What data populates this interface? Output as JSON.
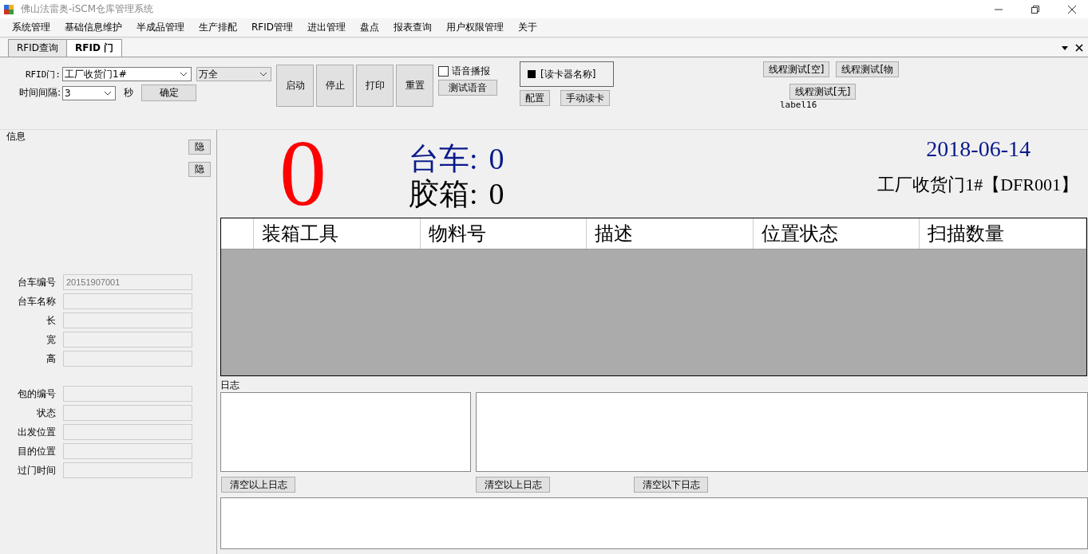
{
  "window": {
    "title": "佛山法雷奥-iSCM仓库管理系统"
  },
  "menu": [
    "系统管理",
    "基础信息维护",
    "半成品管理",
    "生产排配",
    "RFID管理",
    "进出管理",
    "盘点",
    "报表查询",
    "用户权限管理",
    "关于"
  ],
  "tabs": [
    {
      "label": "RFID查询",
      "selected": false
    },
    {
      "label": "RFID 门",
      "selected": true
    }
  ],
  "toolbar": {
    "door_label": "RFID门:",
    "door_value": "工厂收货门1#",
    "site_value": "万全",
    "interval_label": "时间间隔:",
    "interval_value": "3",
    "interval_unit": "秒",
    "confirm": "确定",
    "actions": [
      "启动",
      "停止",
      "打印",
      "重置"
    ],
    "voice": {
      "label": "语音播报",
      "checked": false
    },
    "test_voice": "测试语音",
    "reader": {
      "name": "[读卡器名称]"
    },
    "config": "配置",
    "manual_read": "手动读卡",
    "thread_tests": [
      "线程测试[空]",
      "线程测试[物",
      "线程测试[无]"
    ],
    "status_label": "label16"
  },
  "info": {
    "title": "信息",
    "hide_buttons": [
      "隐",
      "隐"
    ],
    "cart_fields": [
      {
        "label": "台车编号",
        "value": "20151907001"
      },
      {
        "label": "台车名称"
      },
      {
        "label": "长"
      },
      {
        "label": "宽"
      },
      {
        "label": "高"
      }
    ],
    "box_fields": [
      {
        "label": "包的编号"
      },
      {
        "label": "状态"
      },
      {
        "label": "出发位置"
      },
      {
        "label": "目的位置"
      },
      {
        "label": "过门时间"
      }
    ]
  },
  "display": {
    "count": "0",
    "cart_label": "台车:",
    "cart_count": "0",
    "box_label": "胶箱:",
    "box_count": "0",
    "date": "2018-06-14",
    "door_name": "工厂收货门1#【DFR001】"
  },
  "table": {
    "columns": [
      "装箱工具",
      "物料号",
      "描述",
      "位置状态",
      "扫描数量"
    ]
  },
  "log": {
    "title": "日志",
    "clear_buttons": [
      "清空以上日志",
      "清空以上日志",
      "清空以下日志"
    ]
  }
}
